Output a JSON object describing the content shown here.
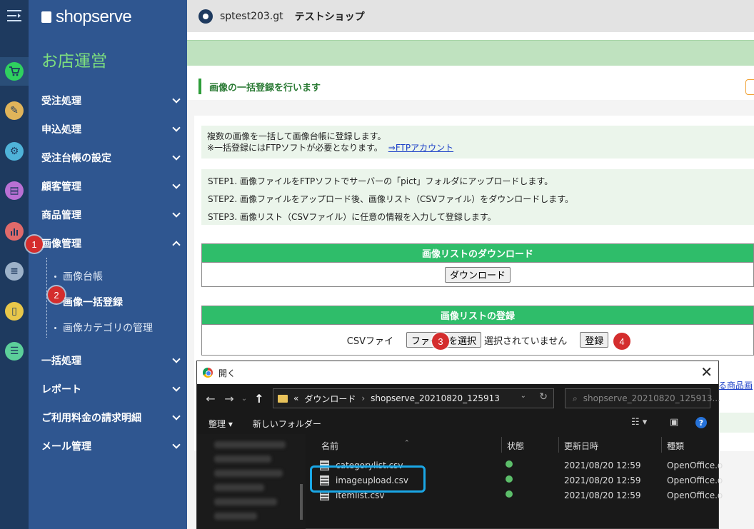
{
  "brand": "shopserve",
  "store_title": "お店運営",
  "nav": {
    "items": [
      {
        "label": "受注処理"
      },
      {
        "label": "申込処理"
      },
      {
        "label": "受注台帳の設定"
      },
      {
        "label": "顧客管理"
      },
      {
        "label": "商品管理"
      },
      {
        "label": "画像管理"
      }
    ],
    "sub_items": [
      {
        "label": "画像台帳"
      },
      {
        "label": "画像一括登録"
      },
      {
        "label": "画像カテゴリの管理"
      }
    ],
    "items_after": [
      {
        "label": "一括処理"
      },
      {
        "label": "レポート"
      },
      {
        "label": "ご利用料金の請求明細"
      },
      {
        "label": "メール管理"
      }
    ]
  },
  "header": {
    "user_id": "sptest203.gt",
    "shop_name": "テストショップ"
  },
  "page": {
    "title": "画像の一括登録を行います",
    "info_line1": "複数の画像を一括して画像台帳に登録します。",
    "info_line2": "※一括登録にはFTPソフトが必要となります。",
    "ftp_link": "⇒FTPアカウント",
    "step1": "STEP1. 画像ファイルをFTPソフトでサーバーの「pict」フォルダにアップロードします。",
    "step2": "STEP2. 画像ファイルをアップロード後、画像リスト（CSVファイル）をダウンロードします。",
    "step3": "STEP3. 画像リスト（CSVファイル）に任意の情報を入力して登録します。",
    "download_header": "画像リストのダウンロード",
    "download_button": "ダウンロード",
    "register_header": "画像リストの登録",
    "csv_label": "CSVファイ",
    "choose_file_button": "ファイルを選択",
    "no_file_text": "選択されていません",
    "register_button": "登録",
    "right_link": "る商品画"
  },
  "badges": [
    "1",
    "2",
    "3",
    "4"
  ],
  "dialog": {
    "title": "開く",
    "path_prefix": "«",
    "path_folder": "ダウンロード",
    "path_sep": "›",
    "path_current": "shopserve_20210820_125913",
    "search_placeholder": "shopserve_20210820_125913...",
    "organize": "整理 ▾",
    "new_folder": "新しいフォルダー",
    "columns": {
      "name": "名前",
      "status": "状態",
      "modified": "更新日時",
      "type": "種類"
    },
    "files": [
      {
        "name": "categorylist.csv",
        "modified": "2021/08/20 12:59",
        "type": "OpenOffice.o"
      },
      {
        "name": "imageupload.csv",
        "modified": "2021/08/20 12:59",
        "type": "OpenOffice.o"
      },
      {
        "name": "itemlist.csv",
        "modified": "2021/08/20 12:59",
        "type": "OpenOffice.o"
      }
    ]
  },
  "colors": {
    "rail": "#1e3a5f",
    "sidebar": "#2f5690",
    "accent_green": "#2fbd6a",
    "badge_red": "#d42d2d",
    "highlight_blue": "#1aa7e6"
  },
  "icons": {
    "rail": [
      "menu-collapse-icon",
      "cart-icon",
      "edit-icon",
      "gear-icon",
      "layout-icon",
      "chart-icon",
      "server-icon",
      "phone-icon",
      "clipboard-icon"
    ]
  }
}
